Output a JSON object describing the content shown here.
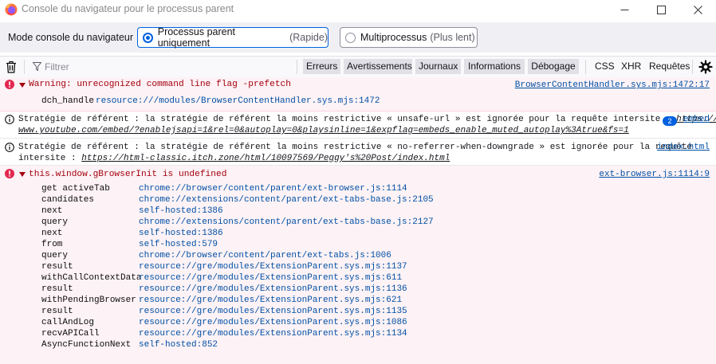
{
  "window": {
    "title": "Console du navigateur pour le processus parent",
    "icon": "firefox-icon",
    "accent": "#0061e0"
  },
  "mode_bar": {
    "label": "Mode console du navigateur",
    "options": [
      {
        "label": "Processus parent uniquement",
        "hint": "(Rapide)",
        "selected": true
      },
      {
        "label": "Multiprocessus",
        "hint": "(Plus lent)",
        "selected": false
      }
    ]
  },
  "toolbar": {
    "filter_placeholder": "Filtrer",
    "filters": [
      "Erreurs",
      "Avertissements",
      "Journaux",
      "Informations",
      "Débogage"
    ],
    "toggles": [
      "CSS",
      "XHR",
      "Requêtes"
    ]
  },
  "messages": [
    {
      "type": "error",
      "text": "Warning: unrecognized command line flag -prefetch",
      "source": "BrowserContentHandler.sys.mjs:1472:17",
      "detail_key": "dch_handle",
      "detail_val": "resource:///modules/BrowserContentHandler.sys.mjs:1472"
    },
    {
      "type": "info",
      "text_prefix": "Stratégie de référent : la stratégie de référent la moins restrictive « unsafe-url » est ignorée pour la requête intersite : ",
      "url_a": "https://",
      "url_b": "www.youtube.com/embed/?enablejsapi=1&rel=0&autoplay=0&playsinline=1&expflag=embeds_enable_muted_autoplay%3Atrue&fs=1",
      "badge": "2",
      "source": "embed"
    },
    {
      "type": "info",
      "line1": "Stratégie de référent : la stratégie de référent la moins restrictive « no-referrer-when-downgrade » est ignorée pour la requête",
      "line2_prefix": "intersite : ",
      "url": "https://html-classic.itch.zone/html/10097569/Peggy's%20Post/index.html",
      "source": "index.html"
    },
    {
      "type": "error",
      "text": "this.window.gBrowserInit is undefined",
      "source": "ext-browser.js:1114:9",
      "stack": [
        {
          "fn": "get activeTab",
          "loc": "chrome://browser/content/parent/ext-browser.js:1114"
        },
        {
          "fn": "candidates",
          "loc": "chrome://extensions/content/parent/ext-tabs-base.js:2105"
        },
        {
          "fn": "next",
          "loc": "self-hosted:1386"
        },
        {
          "fn": "query",
          "loc": "chrome://extensions/content/parent/ext-tabs-base.js:2127"
        },
        {
          "fn": "next",
          "loc": "self-hosted:1386"
        },
        {
          "fn": "from",
          "loc": "self-hosted:579"
        },
        {
          "fn": "query",
          "loc": "chrome://browser/content/parent/ext-tabs.js:1006"
        },
        {
          "fn": "result",
          "loc": "resource://gre/modules/ExtensionParent.sys.mjs:1137"
        },
        {
          "fn": "withCallContextData",
          "loc": "resource://gre/modules/ExtensionParent.sys.mjs:611"
        },
        {
          "fn": "result",
          "loc": "resource://gre/modules/ExtensionParent.sys.mjs:1136"
        },
        {
          "fn": "withPendingBrowser",
          "loc": "resource://gre/modules/ExtensionParent.sys.mjs:621"
        },
        {
          "fn": "result",
          "loc": "resource://gre/modules/ExtensionParent.sys.mjs:1135"
        },
        {
          "fn": "callAndLog",
          "loc": "resource://gre/modules/ExtensionParent.sys.mjs:1086"
        },
        {
          "fn": "recvAPICall",
          "loc": "resource://gre/modules/ExtensionParent.sys.mjs:1134"
        },
        {
          "fn": "AsyncFunctionNext",
          "loc": "self-hosted:852"
        }
      ]
    }
  ]
}
